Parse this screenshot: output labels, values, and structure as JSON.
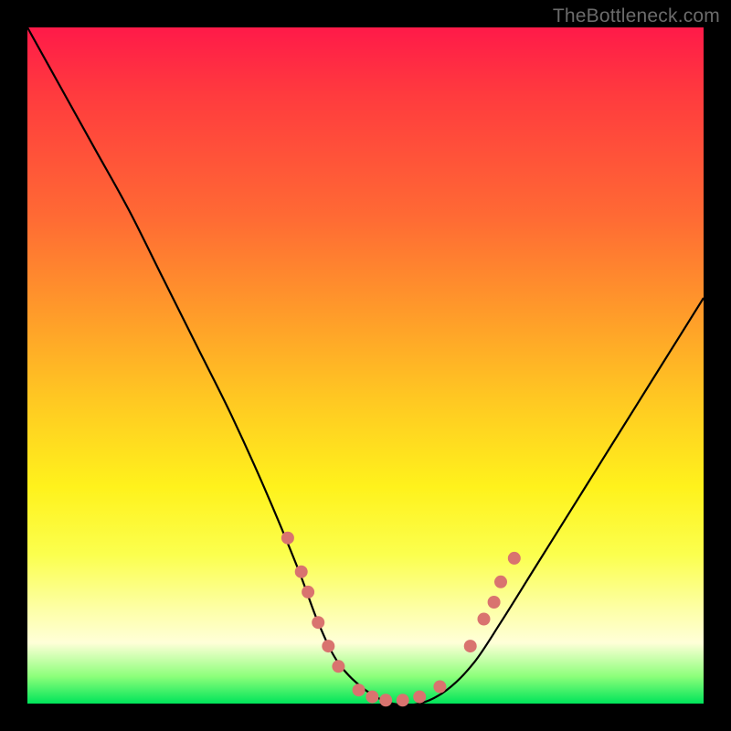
{
  "watermark": "TheBottleneck.com",
  "chart_data": {
    "type": "line",
    "title": "",
    "xlabel": "",
    "ylabel": "",
    "xlim": [
      0,
      1
    ],
    "ylim": [
      0,
      1
    ],
    "series": [
      {
        "name": "curve",
        "x": [
          0.0,
          0.05,
          0.1,
          0.15,
          0.2,
          0.25,
          0.3,
          0.35,
          0.4,
          0.43,
          0.46,
          0.5,
          0.54,
          0.58,
          0.62,
          0.66,
          0.7,
          0.75,
          0.8,
          0.85,
          0.9,
          0.95,
          1.0
        ],
        "y": [
          1.0,
          0.91,
          0.82,
          0.73,
          0.63,
          0.53,
          0.43,
          0.32,
          0.2,
          0.12,
          0.06,
          0.02,
          0.0,
          0.0,
          0.02,
          0.06,
          0.12,
          0.2,
          0.28,
          0.36,
          0.44,
          0.52,
          0.6
        ]
      }
    ],
    "markers": {
      "color": "#d9736f",
      "radius_px": 7,
      "points_xy": [
        [
          0.385,
          0.245
        ],
        [
          0.405,
          0.195
        ],
        [
          0.415,
          0.165
        ],
        [
          0.43,
          0.12
        ],
        [
          0.445,
          0.085
        ],
        [
          0.46,
          0.055
        ],
        [
          0.49,
          0.02
        ],
        [
          0.51,
          0.01
        ],
        [
          0.53,
          0.005
        ],
        [
          0.555,
          0.005
        ],
        [
          0.58,
          0.01
        ],
        [
          0.61,
          0.025
        ],
        [
          0.655,
          0.085
        ],
        [
          0.675,
          0.125
        ],
        [
          0.69,
          0.15
        ],
        [
          0.7,
          0.18
        ],
        [
          0.72,
          0.215
        ]
      ]
    }
  }
}
